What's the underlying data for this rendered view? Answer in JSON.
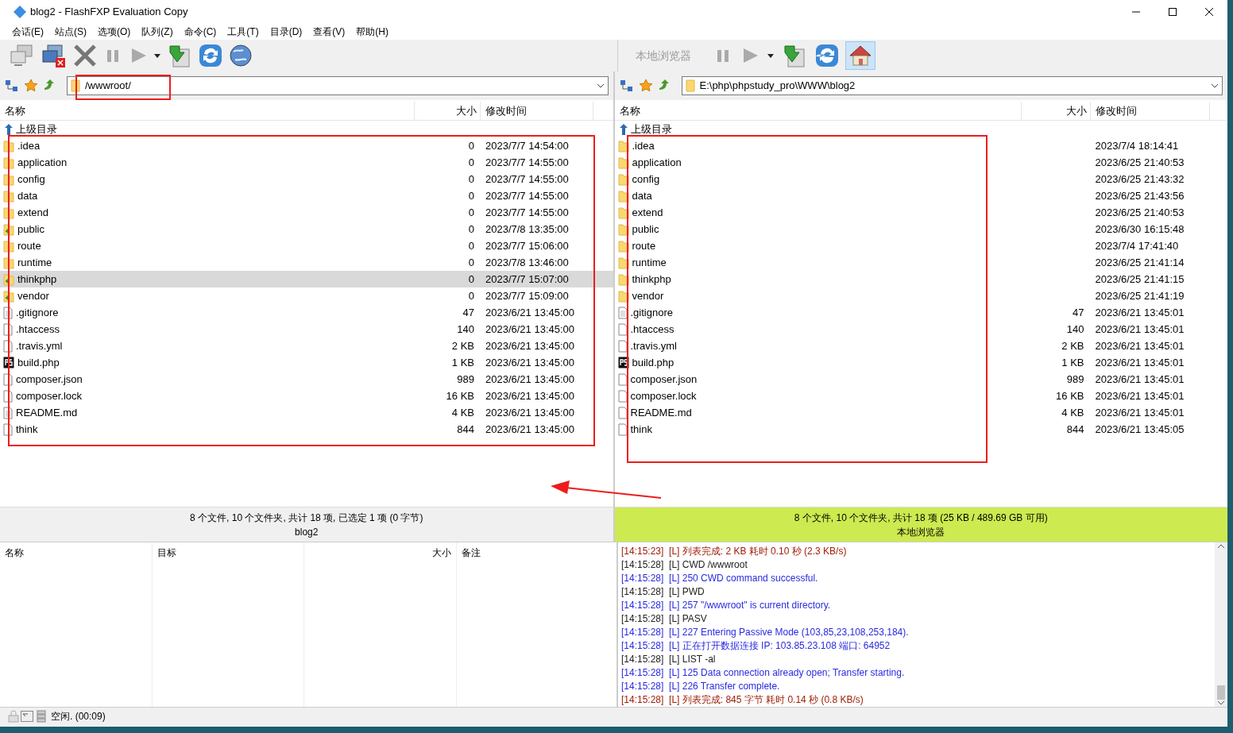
{
  "window": {
    "title": "blog2 - FlashFXP Evaluation Copy"
  },
  "menu": [
    "会话(E)",
    "站点(S)",
    "选项(O)",
    "队列(Z)",
    "命令(C)",
    "工具(T)",
    "目录(D)",
    "查看(V)",
    "帮助(H)"
  ],
  "left_pane": {
    "path": "/wwwroot/",
    "columns": [
      "名称",
      "大小",
      "修改时间"
    ],
    "parent": "上级目录",
    "rows": [
      {
        "name": ".idea",
        "kind": "folder",
        "size": "0",
        "modified": "2023/7/7 14:54:00",
        "selected": false
      },
      {
        "name": "application",
        "kind": "folder",
        "size": "0",
        "modified": "2023/7/7 14:55:00",
        "selected": false
      },
      {
        "name": "config",
        "kind": "folder",
        "size": "0",
        "modified": "2023/7/7 14:55:00",
        "selected": false
      },
      {
        "name": "data",
        "kind": "folder",
        "size": "0",
        "modified": "2023/7/7 14:55:00",
        "selected": false
      },
      {
        "name": "extend",
        "kind": "folder",
        "size": "0",
        "modified": "2023/7/7 14:55:00",
        "selected": false
      },
      {
        "name": "public",
        "kind": "folder-plus",
        "size": "0",
        "modified": "2023/7/8 13:35:00",
        "selected": false
      },
      {
        "name": "route",
        "kind": "folder",
        "size": "0",
        "modified": "2023/7/7 15:06:00",
        "selected": false
      },
      {
        "name": "runtime",
        "kind": "folder",
        "size": "0",
        "modified": "2023/7/8 13:46:00",
        "selected": false
      },
      {
        "name": "thinkphp",
        "kind": "folder-plus",
        "size": "0",
        "modified": "2023/7/7 15:07:00",
        "selected": true
      },
      {
        "name": "vendor",
        "kind": "folder-plus",
        "size": "0",
        "modified": "2023/7/7 15:09:00",
        "selected": false
      },
      {
        "name": ".gitignore",
        "kind": "text",
        "size": "47",
        "modified": "2023/6/21 13:45:00",
        "selected": false
      },
      {
        "name": ".htaccess",
        "kind": "file",
        "size": "140",
        "modified": "2023/6/21 13:45:00",
        "selected": false
      },
      {
        "name": ".travis.yml",
        "kind": "file",
        "size": "2 KB",
        "modified": "2023/6/21 13:45:00",
        "selected": false
      },
      {
        "name": "build.php",
        "kind": "php",
        "size": "1 KB",
        "modified": "2023/6/21 13:45:00",
        "selected": false
      },
      {
        "name": "composer.json",
        "kind": "file",
        "size": "989",
        "modified": "2023/6/21 13:45:00",
        "selected": false
      },
      {
        "name": "composer.lock",
        "kind": "file",
        "size": "16 KB",
        "modified": "2023/6/21 13:45:00",
        "selected": false
      },
      {
        "name": "README.md",
        "kind": "text",
        "size": "4 KB",
        "modified": "2023/6/21 13:45:00",
        "selected": false
      },
      {
        "name": "think",
        "kind": "file",
        "size": "844",
        "modified": "2023/6/21 13:45:00",
        "selected": false
      }
    ],
    "summary": "8 个文件, 10 个文件夹, 共计 18 项, 已选定 1 项 (0 字节)",
    "label": "blog2"
  },
  "right_pane": {
    "title": "本地浏览器",
    "home_active": true,
    "path": "E:\\php\\phpstudy_pro\\WWW\\blog2",
    "columns": [
      "名称",
      "大小",
      "修改时间"
    ],
    "parent": "上级目录",
    "rows": [
      {
        "name": ".idea",
        "kind": "folder",
        "size": "",
        "modified": "2023/7/4 18:14:41",
        "selected": false
      },
      {
        "name": "application",
        "kind": "folder",
        "size": "",
        "modified": "2023/6/25 21:40:53",
        "selected": false
      },
      {
        "name": "config",
        "kind": "folder",
        "size": "",
        "modified": "2023/6/25 21:43:32",
        "selected": false
      },
      {
        "name": "data",
        "kind": "folder",
        "size": "",
        "modified": "2023/6/25 21:43:56",
        "selected": false
      },
      {
        "name": "extend",
        "kind": "folder",
        "size": "",
        "modified": "2023/6/25 21:40:53",
        "selected": false
      },
      {
        "name": "public",
        "kind": "folder",
        "size": "",
        "modified": "2023/6/30 16:15:48",
        "selected": false
      },
      {
        "name": "route",
        "kind": "folder",
        "size": "",
        "modified": "2023/7/4 17:41:40",
        "selected": false
      },
      {
        "name": "runtime",
        "kind": "folder",
        "size": "",
        "modified": "2023/6/25 21:41:14",
        "selected": false
      },
      {
        "name": "thinkphp",
        "kind": "folder",
        "size": "",
        "modified": "2023/6/25 21:41:15",
        "selected": false
      },
      {
        "name": "vendor",
        "kind": "folder",
        "size": "",
        "modified": "2023/6/25 21:41:19",
        "selected": false
      },
      {
        "name": ".gitignore",
        "kind": "text",
        "size": "47",
        "modified": "2023/6/21 13:45:01",
        "selected": false
      },
      {
        "name": ".htaccess",
        "kind": "file",
        "size": "140",
        "modified": "2023/6/21 13:45:01",
        "selected": false
      },
      {
        "name": ".travis.yml",
        "kind": "file",
        "size": "2 KB",
        "modified": "2023/6/21 13:45:01",
        "selected": false
      },
      {
        "name": "build.php",
        "kind": "php",
        "size": "1 KB",
        "modified": "2023/6/21 13:45:01",
        "selected": false
      },
      {
        "name": "composer.json",
        "kind": "file",
        "size": "989",
        "modified": "2023/6/21 13:45:01",
        "selected": false
      },
      {
        "name": "composer.lock",
        "kind": "file",
        "size": "16 KB",
        "modified": "2023/6/21 13:45:01",
        "selected": false
      },
      {
        "name": "README.md",
        "kind": "file",
        "size": "4 KB",
        "modified": "2023/6/21 13:45:01",
        "selected": false
      },
      {
        "name": "think",
        "kind": "file",
        "size": "844",
        "modified": "2023/6/21 13:45:05",
        "selected": false
      }
    ],
    "summary": "8 个文件, 10 个文件夹, 共计 18 项 (25 KB / 489.69 GB 可用)",
    "label": "本地浏览器"
  },
  "queue": {
    "columns": [
      "名称",
      "目标",
      "大小",
      "备注"
    ]
  },
  "log": [
    {
      "text": "[14:15:23]  [L] 列表完成: 2 KB 耗时 0.10 秒 (2.3 KB/s)",
      "kind": "status"
    },
    {
      "text": "[14:15:28]  [L] CWD /wwwroot",
      "kind": "command"
    },
    {
      "text": "[14:15:28]  [L] 250 CWD command successful.",
      "kind": "reply"
    },
    {
      "text": "[14:15:28]  [L] PWD",
      "kind": "command"
    },
    {
      "text": "[14:15:28]  [L] 257 \"/wwwroot\" is current directory.",
      "kind": "reply"
    },
    {
      "text": "[14:15:28]  [L] PASV",
      "kind": "command"
    },
    {
      "text": "[14:15:28]  [L] 227 Entering Passive Mode (103,85,23,108,253,184).",
      "kind": "reply"
    },
    {
      "text": "[14:15:28]  [L] 正在打开数据连接 IP: 103.85.23.108 端口: 64952",
      "kind": "reply"
    },
    {
      "text": "[14:15:28]  [L] LIST -al",
      "kind": "command"
    },
    {
      "text": "[14:15:28]  [L] 125 Data connection already open; Transfer starting.",
      "kind": "reply"
    },
    {
      "text": "[14:15:28]  [L] 226 Transfer complete.",
      "kind": "reply"
    },
    {
      "text": "[14:15:28]  [L] 列表完成: 845 字节 耗时 0.14 秒 (0.8 KB/s)",
      "kind": "status"
    }
  ],
  "status_bar": {
    "text": "空闲. (00:09)"
  }
}
